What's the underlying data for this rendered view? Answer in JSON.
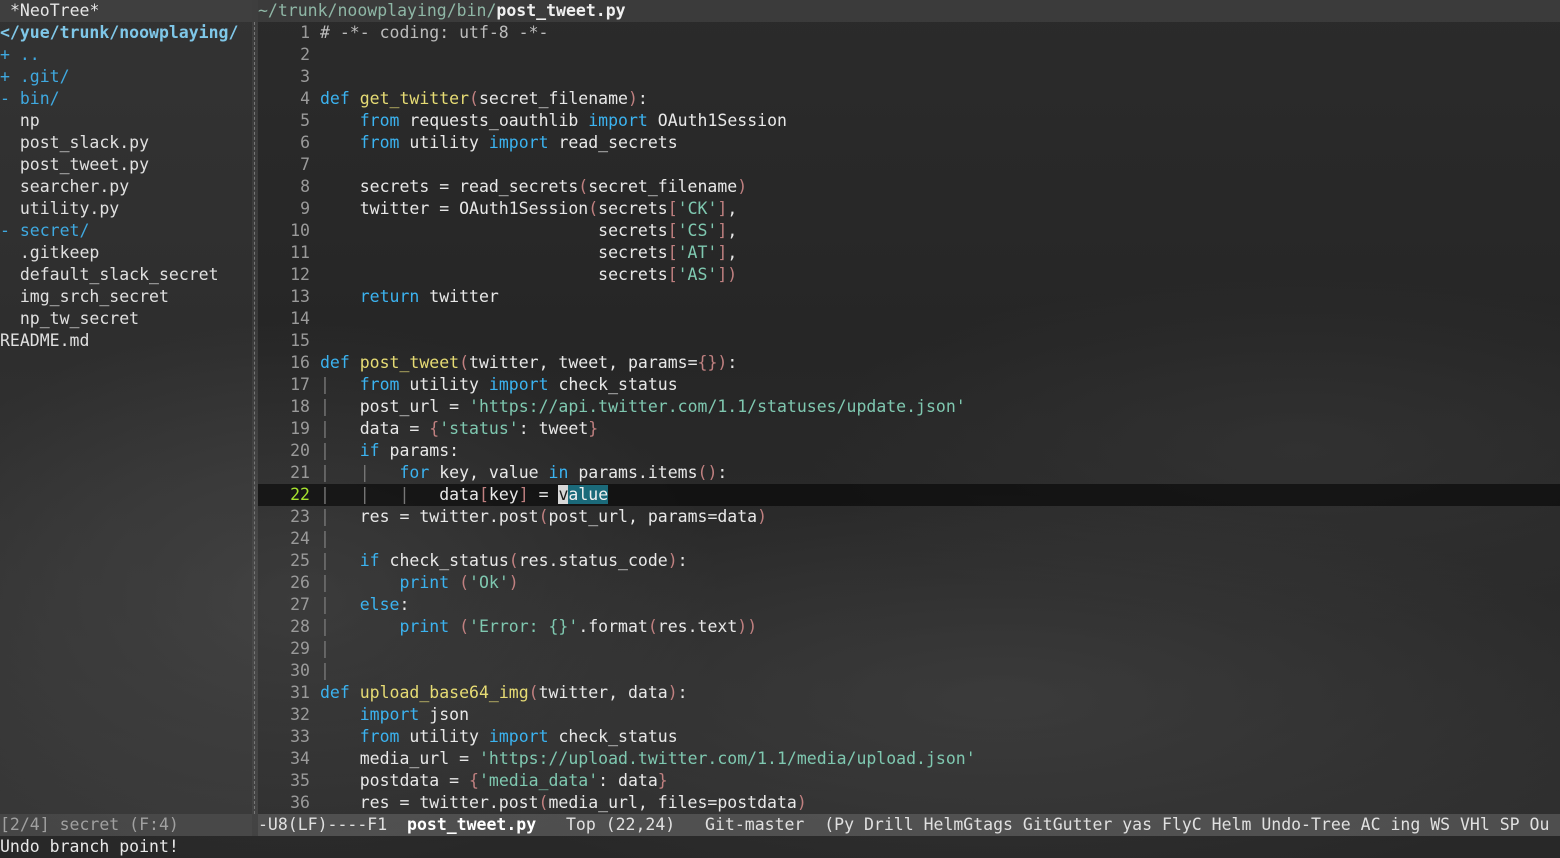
{
  "neotree": {
    "header": "*NeoTree*",
    "root": "</yue/trunk/noowplaying/",
    "items": [
      {
        "prefix": "+ ",
        "name": "..",
        "type": "dir"
      },
      {
        "prefix": "+ ",
        "name": ".git/",
        "type": "dir"
      },
      {
        "prefix": "- ",
        "name": "bin/",
        "type": "dir"
      },
      {
        "prefix": "  ",
        "name": "np",
        "type": "file"
      },
      {
        "prefix": "  ",
        "name": "post_slack.py",
        "type": "file"
      },
      {
        "prefix": "  ",
        "name": "post_tweet.py",
        "type": "file"
      },
      {
        "prefix": "  ",
        "name": "searcher.py",
        "type": "file"
      },
      {
        "prefix": "  ",
        "name": "utility.py",
        "type": "file"
      },
      {
        "prefix": "- ",
        "name": "secret/",
        "type": "dir"
      },
      {
        "prefix": "  ",
        "name": ".gitkeep",
        "type": "file"
      },
      {
        "prefix": "  ",
        "name": "default_slack_secret",
        "type": "file"
      },
      {
        "prefix": "  ",
        "name": "img_srch_secret",
        "type": "file"
      },
      {
        "prefix": "  ",
        "name": "np_tw_secret",
        "type": "file"
      },
      {
        "prefix": "",
        "name": "README.md",
        "type": "file"
      }
    ],
    "modeline": "[2/4] secret (F:4)"
  },
  "editor": {
    "path_dir": "~/trunk/noowplaying/bin/",
    "path_file": "post_tweet.py",
    "current_line": 22,
    "lines": [
      {
        "n": "1",
        "s": [
          [
            "cm",
            "# -*- coding: utf-8 -*-"
          ]
        ]
      },
      {
        "n": "2",
        "s": []
      },
      {
        "n": "3",
        "s": []
      },
      {
        "n": "4",
        "s": [
          [
            "kw",
            "def "
          ],
          [
            "fn",
            "get_twitter"
          ],
          [
            "par",
            "("
          ],
          [
            "txt",
            "secret_filename"
          ],
          [
            "par",
            ")"
          ],
          [
            "txt",
            ":"
          ]
        ]
      },
      {
        "n": "5",
        "s": [
          [
            "txt",
            "    "
          ],
          [
            "kw",
            "from"
          ],
          [
            "txt",
            " requests_oauthlib "
          ],
          [
            "kw",
            "import"
          ],
          [
            "txt",
            " OAuth1Session"
          ]
        ]
      },
      {
        "n": "6",
        "s": [
          [
            "txt",
            "    "
          ],
          [
            "kw",
            "from"
          ],
          [
            "txt",
            " utility "
          ],
          [
            "kw",
            "import"
          ],
          [
            "txt",
            " read_secrets"
          ]
        ]
      },
      {
        "n": "7",
        "s": []
      },
      {
        "n": "8",
        "s": [
          [
            "txt",
            "    secrets = read_secrets"
          ],
          [
            "par",
            "("
          ],
          [
            "txt",
            "secret_filename"
          ],
          [
            "par",
            ")"
          ]
        ]
      },
      {
        "n": "9",
        "s": [
          [
            "txt",
            "    twitter = OAuth1Session"
          ],
          [
            "par",
            "("
          ],
          [
            "txt",
            "secrets"
          ],
          [
            "par",
            "["
          ],
          [
            "str",
            "'CK'"
          ],
          [
            "par",
            "]"
          ],
          [
            "txt",
            ","
          ]
        ]
      },
      {
        "n": "10",
        "s": [
          [
            "txt",
            "                            secrets"
          ],
          [
            "par",
            "["
          ],
          [
            "str",
            "'CS'"
          ],
          [
            "par",
            "]"
          ],
          [
            "txt",
            ","
          ]
        ]
      },
      {
        "n": "11",
        "s": [
          [
            "txt",
            "                            secrets"
          ],
          [
            "par",
            "["
          ],
          [
            "str",
            "'AT'"
          ],
          [
            "par",
            "]"
          ],
          [
            "txt",
            ","
          ]
        ]
      },
      {
        "n": "12",
        "s": [
          [
            "txt",
            "                            secrets"
          ],
          [
            "par",
            "["
          ],
          [
            "str",
            "'AS'"
          ],
          [
            "par",
            "])"
          ]
        ]
      },
      {
        "n": "13",
        "s": [
          [
            "txt",
            "    "
          ],
          [
            "kw",
            "return"
          ],
          [
            "txt",
            " twitter"
          ]
        ]
      },
      {
        "n": "14",
        "s": []
      },
      {
        "n": "15",
        "s": []
      },
      {
        "n": "16",
        "s": [
          [
            "kw",
            "def "
          ],
          [
            "fn",
            "post_tweet"
          ],
          [
            "par",
            "("
          ],
          [
            "txt",
            "twitter, tweet, params="
          ],
          [
            "par",
            "{}"
          ],
          [
            "par",
            ")"
          ],
          [
            "txt",
            ":"
          ]
        ]
      },
      {
        "n": "17",
        "s": [
          [
            "guide",
            "|   "
          ],
          [
            "kw",
            "from"
          ],
          [
            "txt",
            " utility "
          ],
          [
            "kw",
            "import"
          ],
          [
            "txt",
            " check_status"
          ]
        ]
      },
      {
        "n": "18",
        "s": [
          [
            "guide",
            "|   "
          ],
          [
            "txt",
            "post_url = "
          ],
          [
            "str",
            "'https://api.twitter.com/1.1/statuses/update.json'"
          ]
        ]
      },
      {
        "n": "19",
        "s": [
          [
            "guide",
            "|   "
          ],
          [
            "txt",
            "data = "
          ],
          [
            "par",
            "{"
          ],
          [
            "str",
            "'status'"
          ],
          [
            "txt",
            ": tweet"
          ],
          [
            "par",
            "}"
          ]
        ]
      },
      {
        "n": "20",
        "s": [
          [
            "guide",
            "|   "
          ],
          [
            "kw",
            "if"
          ],
          [
            "txt",
            " params:"
          ]
        ]
      },
      {
        "n": "21",
        "s": [
          [
            "guide",
            "|   |   "
          ],
          [
            "kw",
            "for"
          ],
          [
            "txt",
            " key, value "
          ],
          [
            "kw",
            "in"
          ],
          [
            "txt",
            " params.items"
          ],
          [
            "par",
            "()"
          ],
          [
            "txt",
            ":"
          ]
        ]
      },
      {
        "n": "22",
        "s": [
          [
            "guide",
            "|   |   |   "
          ],
          [
            "txt",
            "data"
          ],
          [
            "par",
            "["
          ],
          [
            "txt",
            "key"
          ],
          [
            "par",
            "]"
          ],
          [
            "txt",
            " = "
          ],
          [
            "cur",
            "v"
          ],
          [
            "hl",
            "alue"
          ]
        ]
      },
      {
        "n": "23",
        "s": [
          [
            "guide",
            "|   "
          ],
          [
            "txt",
            "res = twitter.post"
          ],
          [
            "par",
            "("
          ],
          [
            "txt",
            "post_url, params=data"
          ],
          [
            "par",
            ")"
          ]
        ]
      },
      {
        "n": "24",
        "s": [
          [
            "guide",
            "|"
          ]
        ]
      },
      {
        "n": "25",
        "s": [
          [
            "guide",
            "|   "
          ],
          [
            "kw",
            "if"
          ],
          [
            "txt",
            " check_status"
          ],
          [
            "par",
            "("
          ],
          [
            "txt",
            "res.status_code"
          ],
          [
            "par",
            ")"
          ],
          [
            "txt",
            ":"
          ]
        ]
      },
      {
        "n": "26",
        "s": [
          [
            "guide",
            "|       "
          ],
          [
            "kw",
            "print"
          ],
          [
            "txt",
            " "
          ],
          [
            "par",
            "("
          ],
          [
            "str",
            "'Ok'"
          ],
          [
            "par",
            ")"
          ]
        ]
      },
      {
        "n": "27",
        "s": [
          [
            "guide",
            "|   "
          ],
          [
            "kw",
            "else"
          ],
          [
            "txt",
            ":"
          ]
        ]
      },
      {
        "n": "28",
        "s": [
          [
            "guide",
            "|       "
          ],
          [
            "kw",
            "print"
          ],
          [
            "txt",
            " "
          ],
          [
            "par",
            "("
          ],
          [
            "str",
            "'Error: {}'"
          ],
          [
            "txt",
            ".format"
          ],
          [
            "par",
            "("
          ],
          [
            "txt",
            "res.text"
          ],
          [
            "par",
            "))"
          ]
        ]
      },
      {
        "n": "29",
        "s": [
          [
            "guide",
            "|"
          ]
        ]
      },
      {
        "n": "30",
        "s": [
          [
            "guide",
            "|"
          ]
        ]
      },
      {
        "n": "31",
        "s": [
          [
            "kw",
            "def "
          ],
          [
            "fn",
            "upload_base64_img"
          ],
          [
            "par",
            "("
          ],
          [
            "txt",
            "twitter, data"
          ],
          [
            "par",
            ")"
          ],
          [
            "txt",
            ":"
          ]
        ]
      },
      {
        "n": "32",
        "s": [
          [
            "txt",
            "    "
          ],
          [
            "kw",
            "import"
          ],
          [
            "txt",
            " json"
          ]
        ]
      },
      {
        "n": "33",
        "s": [
          [
            "txt",
            "    "
          ],
          [
            "kw",
            "from"
          ],
          [
            "txt",
            " utility "
          ],
          [
            "kw",
            "import"
          ],
          [
            "txt",
            " check_status"
          ]
        ]
      },
      {
        "n": "34",
        "s": [
          [
            "txt",
            "    media_url = "
          ],
          [
            "str",
            "'https://upload.twitter.com/1.1/media/upload.json'"
          ]
        ]
      },
      {
        "n": "35",
        "s": [
          [
            "txt",
            "    postdata = "
          ],
          [
            "par",
            "{"
          ],
          [
            "str",
            "'media_data'"
          ],
          [
            "txt",
            ": data"
          ],
          [
            "par",
            "}"
          ]
        ]
      },
      {
        "n": "36",
        "s": [
          [
            "txt",
            "    res = twitter.post"
          ],
          [
            "par",
            "("
          ],
          [
            "txt",
            "media_url, files=postdata"
          ],
          [
            "par",
            ")"
          ]
        ]
      }
    ]
  },
  "modeline": {
    "left": "-U8(LF)----F1  ",
    "file": "post_tweet.py",
    "position": "   Top (22,24)   Git-master  (Py Drill HelmGtags GitGutter yas FlyC Helm Undo-Tree AC ing WS VHl SP Ou"
  },
  "echo": "Undo branch point!",
  "colors": {
    "keyword": "#3bb3f0",
    "function": "#e6db74",
    "string": "#7fc8b0",
    "bracket": "#c08080",
    "region": "#1b6a7a"
  }
}
